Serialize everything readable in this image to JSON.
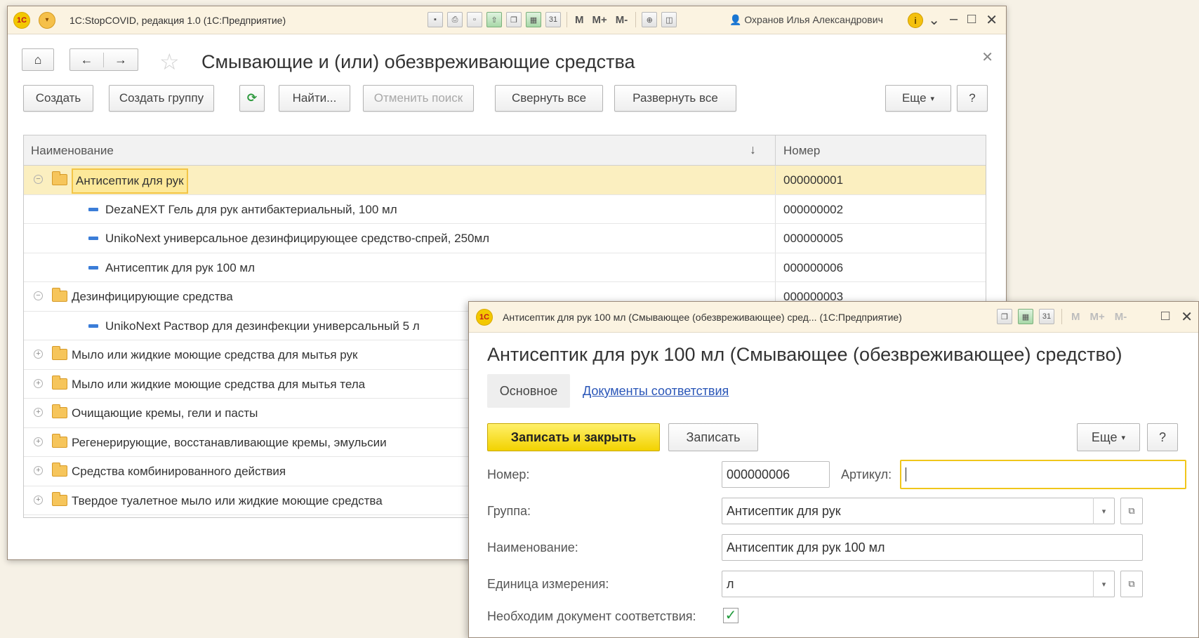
{
  "main_window": {
    "app_title": "1С:StopCOVID, редакция 1.0  (1С:Предприятие)",
    "user_name": "Охранов Илья Александрович",
    "page_title": "Смывающие и (или) обезвреживающие средства",
    "toolbar_m": [
      "M",
      "M+",
      "M-"
    ],
    "buttons": {
      "create": "Создать",
      "create_group": "Создать группу",
      "find": "Найти...",
      "cancel_search": "Отменить поиск",
      "collapse_all": "Свернуть все",
      "expand_all": "Развернуть все",
      "more": "Еще",
      "help": "?"
    },
    "table": {
      "columns": [
        "Наименование",
        "Номер"
      ],
      "rows": [
        {
          "type": "group",
          "expanded": true,
          "selected": true,
          "name": "Антисептик для рук",
          "number": "000000001"
        },
        {
          "type": "item",
          "name": "DezaNEXT Гель для рук антибактериальный, 100 мл",
          "number": "000000002"
        },
        {
          "type": "item",
          "name": "UnikoNext универсальное дезинфицирующее средство-спрей, 250мл",
          "number": "000000005"
        },
        {
          "type": "item",
          "name": "Антисептик для рук 100 мл",
          "number": "000000006"
        },
        {
          "type": "group",
          "expanded": true,
          "name": "Дезинфицирующие средства",
          "number": "000000003"
        },
        {
          "type": "item",
          "name": "UnikoNext Раствор для дезинфекции универсальный 5 л",
          "number": ""
        },
        {
          "type": "group",
          "expanded": false,
          "name": "Мыло или жидкие моющие средства для мытья рук",
          "number": ""
        },
        {
          "type": "group",
          "expanded": false,
          "name": "Мыло или жидкие моющие средства для мытья тела",
          "number": ""
        },
        {
          "type": "group",
          "expanded": false,
          "name": "Очищающие кремы, гели и пасты",
          "number": ""
        },
        {
          "type": "group",
          "expanded": false,
          "name": "Регенерирующие, восстанавливающие кремы, эмульсии",
          "number": ""
        },
        {
          "type": "group",
          "expanded": false,
          "name": "Средства комбинированного действия",
          "number": ""
        },
        {
          "type": "group",
          "expanded": false,
          "name": "Твердое туалетное мыло или жидкие моющие средства",
          "number": ""
        }
      ]
    }
  },
  "dialog": {
    "window_title": "Антисептик для рук 100 мл (Смывающее (обезвреживающее) сред...  (1С:Предприятие)",
    "title": "Антисептик для рук 100 мл (Смывающее (обезвреживающее) средство)",
    "toolbar_m": [
      "M",
      "M+",
      "M-"
    ],
    "tabs": {
      "main": "Основное",
      "docs": "Документы соответствия"
    },
    "buttons": {
      "save_close": "Записать и закрыть",
      "save": "Записать",
      "more": "Еще",
      "help": "?"
    },
    "fields": {
      "number_label": "Номер:",
      "number_value": "000000006",
      "article_label": "Артикул:",
      "article_value": "",
      "group_label": "Группа:",
      "group_value": "Антисептик для рук",
      "name_label": "Наименование:",
      "name_value": "Антисептик для рук 100 мл",
      "unit_label": "Единица измерения:",
      "unit_value": "л",
      "doc_required_label": "Необходим документ соответствия:",
      "doc_required_checked": true
    }
  },
  "colors": {
    "title_bar": "#fbf3e1",
    "selection": "#fbefc0",
    "primary_button": "#f2d200",
    "link": "#2a56b8",
    "item_icon": "#3b7dd8",
    "folder": "#f6c55b"
  },
  "icons": [
    "1c-logo-icon",
    "main-menu-icon",
    "home-icon",
    "back-arrow-icon",
    "forward-arrow-icon",
    "star-icon",
    "close-icon",
    "copy-icon",
    "folder-icon",
    "item-icon",
    "checkmark-icon"
  ]
}
